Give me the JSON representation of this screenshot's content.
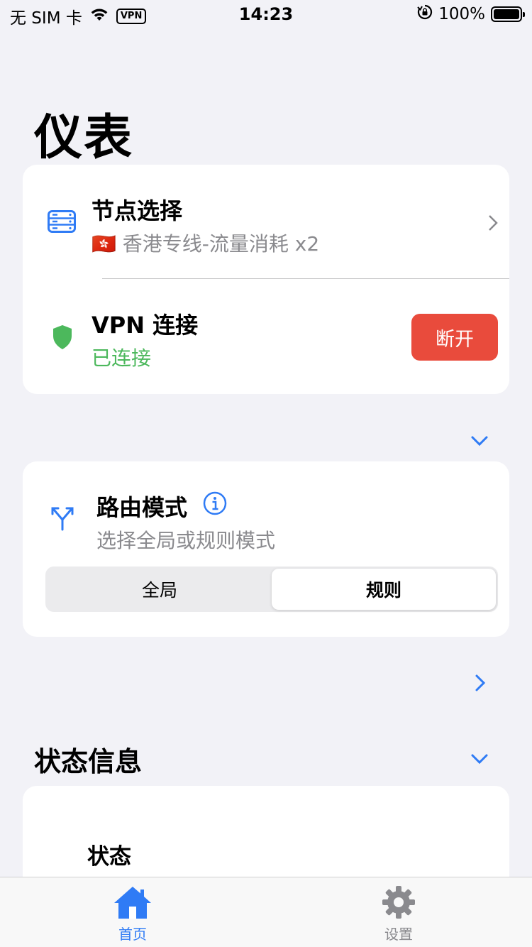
{
  "status_bar": {
    "carrier": "无 SIM 卡",
    "vpn_badge": "VPN",
    "time": "14:23",
    "battery": "100%"
  },
  "page": {
    "title": "仪表"
  },
  "node_card": {
    "title": "节点选择",
    "flag": "🇭🇰",
    "node_name": "香港专线-流量消耗 x2",
    "icon": "server-icon"
  },
  "vpn_card": {
    "title": "VPN 连接",
    "status": "已连接",
    "button_label": "断开",
    "icon": "shield-icon"
  },
  "route_card": {
    "title": "路由模式",
    "subtitle": "选择全局或规则模式",
    "options": [
      "全局",
      "规则"
    ],
    "selected": "规则",
    "icon": "fork-icon"
  },
  "status_section": {
    "title": "状态信息",
    "item_label": "状态"
  },
  "tab_bar": {
    "tabs": [
      {
        "label": "首页",
        "icon": "home-icon",
        "active": true
      },
      {
        "label": "设置",
        "icon": "gear-icon",
        "active": false
      }
    ]
  },
  "colors": {
    "accent": "#2f7bf5",
    "success": "#4cb85c",
    "danger": "#e94b3c",
    "background": "#f2f2f7"
  }
}
